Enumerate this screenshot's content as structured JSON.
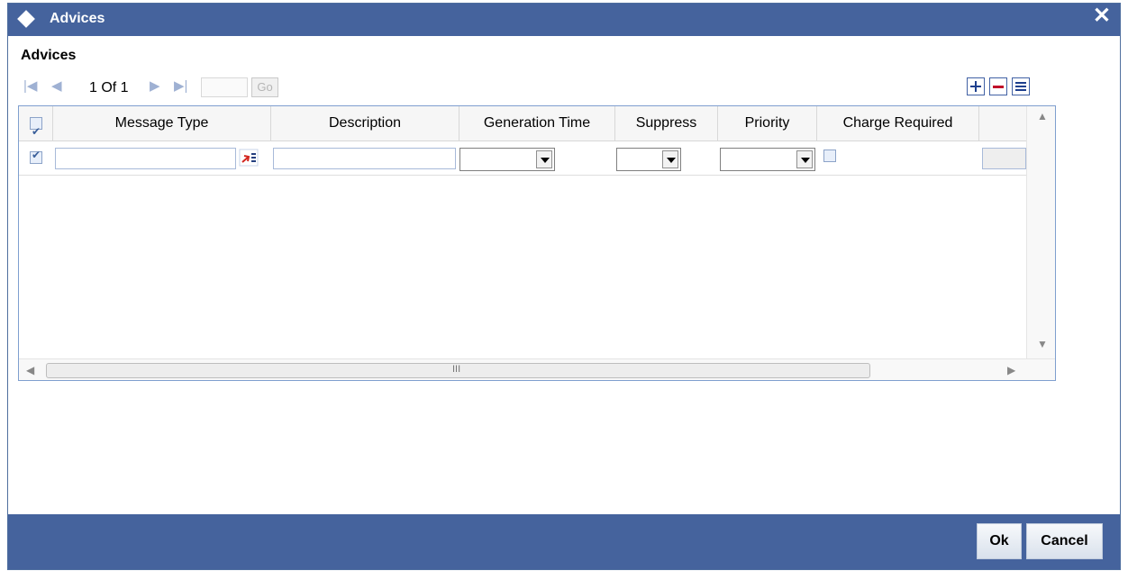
{
  "window": {
    "title": "Advices",
    "close_glyph": "✕"
  },
  "section": {
    "title": "Advices"
  },
  "pagination": {
    "page_info": "1 Of 1",
    "page_input": "",
    "go_label": "Go"
  },
  "toolbar": {
    "add_icon": "plus-icon",
    "delete_icon": "minus-icon",
    "view_icon": "list-icon"
  },
  "grid": {
    "columns": [
      "Message Type",
      "Description",
      "Generation Time",
      "Suppress",
      "Priority",
      "Charge Required"
    ],
    "rows": [
      {
        "checked": true,
        "message_type": "",
        "description": "",
        "generation_time": "",
        "suppress": "",
        "priority": "",
        "charge_required": false
      }
    ],
    "scroll_thumb_label": "III"
  },
  "buttons": {
    "ok": "Ok",
    "cancel": "Cancel"
  },
  "colors": {
    "titlebar": "#45639d",
    "footer": "#45639d"
  }
}
